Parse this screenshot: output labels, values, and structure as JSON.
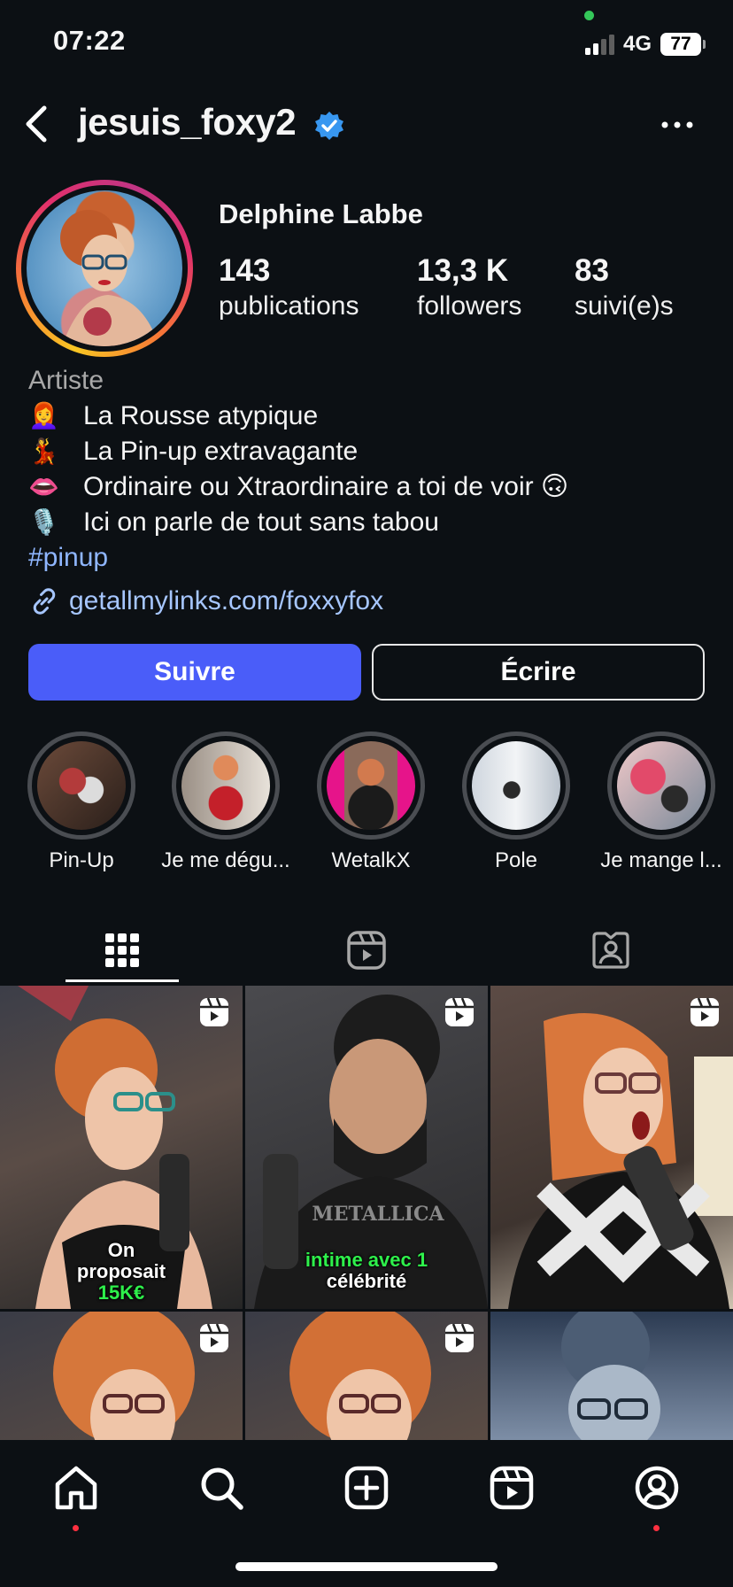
{
  "status_bar": {
    "time": "07:22",
    "network": "4G",
    "battery": "77"
  },
  "header": {
    "username": "jesuis_foxy2"
  },
  "profile": {
    "full_name": "Delphine Labbe",
    "stats": [
      {
        "value": "143",
        "label": "publications"
      },
      {
        "value": "13,3 K",
        "label": "followers"
      },
      {
        "value": "83",
        "label": "suivi(e)s"
      }
    ],
    "category": "Artiste",
    "bio_lines": [
      {
        "emoji": "👩‍🦰",
        "text": "La Rousse atypique"
      },
      {
        "emoji": "💃",
        "text": "La Pin-up extravagante"
      },
      {
        "emoji": "👄",
        "text": "Ordinaire ou Xtraordinaire a toi de voir 🙃"
      },
      {
        "emoji": "🎙️",
        "text": "Ici on parle de tout sans tabou"
      }
    ],
    "hashtag": "#pinup",
    "link": "getallmylinks.com/foxxyfox"
  },
  "actions": {
    "follow": "Suivre",
    "message": "Écrire"
  },
  "highlights": [
    {
      "label": "Pin-Up"
    },
    {
      "label": "Je me dégu..."
    },
    {
      "label": "WetalkX"
    },
    {
      "label": "Pole"
    },
    {
      "label": "Je mange l..."
    }
  ],
  "posts": [
    {
      "caption_line1": "On",
      "caption_line2": "proposait",
      "caption_line3": "15K€"
    },
    {
      "caption_line1": "intime avec 1",
      "caption_line2": "célébrité"
    }
  ],
  "colors": {
    "background": "#0c1014",
    "follow_button": "#4a5df9",
    "link": "#a6c6ff",
    "notification_dot": "#ff3040"
  }
}
